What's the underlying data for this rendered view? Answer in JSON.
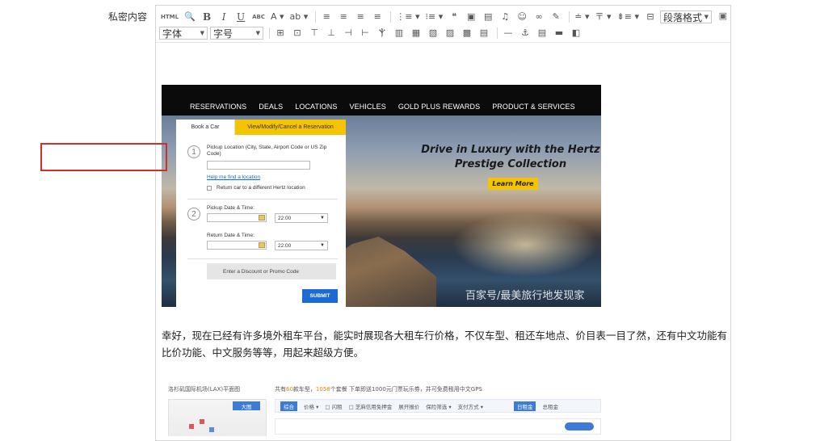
{
  "field": {
    "label": "私密内容"
  },
  "toolbar": {
    "row1": [
      {
        "name": "source-code-button",
        "glyph": "HTML",
        "cls": "small"
      },
      {
        "name": "preview-icon",
        "glyph": "🔍",
        "cls": ""
      },
      {
        "name": "bold-button",
        "glyph": "B",
        "cls": "bold"
      },
      {
        "name": "italic-button",
        "glyph": "I",
        "cls": "ital"
      },
      {
        "name": "underline-button",
        "glyph": "U",
        "cls": "under"
      },
      {
        "name": "strikethrough-button",
        "glyph": "ABC",
        "cls": "small"
      },
      {
        "name": "font-color-button",
        "glyph": "A ▾",
        "cls": ""
      },
      {
        "name": "background-color-button",
        "glyph": "ab ▾",
        "cls": ""
      },
      {
        "sep": true
      },
      {
        "name": "align-left-icon",
        "glyph": "≡",
        "cls": ""
      },
      {
        "name": "align-center-icon",
        "glyph": "≡",
        "cls": ""
      },
      {
        "name": "align-right-icon",
        "glyph": "≡",
        "cls": ""
      },
      {
        "name": "align-justify-icon",
        "glyph": "≡",
        "cls": ""
      },
      {
        "sep": true
      },
      {
        "name": "ordered-list-icon",
        "glyph": "⋮≡ ▾",
        "cls": ""
      },
      {
        "name": "unordered-list-icon",
        "glyph": "⁝≡ ▾",
        "cls": ""
      },
      {
        "name": "blockquote-icon",
        "glyph": "❝",
        "cls": ""
      },
      {
        "name": "image-icon",
        "glyph": "▣",
        "cls": ""
      },
      {
        "name": "file-icon",
        "glyph": "▤",
        "cls": ""
      },
      {
        "name": "music-icon",
        "glyph": "♫",
        "cls": ""
      },
      {
        "name": "emoticon-icon",
        "glyph": "☺",
        "cls": ""
      },
      {
        "name": "link-icon",
        "glyph": "∞",
        "cls": ""
      },
      {
        "name": "clear-format-icon",
        "glyph": "✎",
        "cls": ""
      },
      {
        "sep": true
      },
      {
        "name": "line-height-icon",
        "glyph": "≐ ▾",
        "cls": ""
      },
      {
        "name": "paragraph-spacing-icon",
        "glyph": "〒 ▾",
        "cls": ""
      },
      {
        "name": "indent-icon",
        "glyph": "⇟≡ ▾",
        "cls": ""
      },
      {
        "name": "direction-icon",
        "glyph": "⊟",
        "cls": ""
      }
    ],
    "paragraph_format": "段落格式",
    "font_family": "字体",
    "font_size": "字号",
    "row2": [
      {
        "name": "table-icon",
        "glyph": "⊞"
      },
      {
        "name": "insert-table-icon",
        "glyph": "⊡"
      },
      {
        "name": "insert-row-above-icon",
        "glyph": "⊤"
      },
      {
        "name": "insert-row-below-icon",
        "glyph": "⊥"
      },
      {
        "name": "insert-col-left-icon",
        "glyph": "⊣"
      },
      {
        "name": "insert-col-right-icon",
        "glyph": "⊢"
      },
      {
        "name": "delete-row-icon",
        "glyph": "Ⲯ"
      },
      {
        "name": "delete-col-icon",
        "glyph": "▥"
      },
      {
        "name": "merge-cells-icon",
        "glyph": "▦"
      },
      {
        "name": "merge-right-icon",
        "glyph": "▧"
      },
      {
        "name": "merge-down-icon",
        "glyph": "▨"
      },
      {
        "name": "split-cells-icon",
        "glyph": "▩"
      },
      {
        "name": "split-rows-icon",
        "glyph": "▤"
      },
      {
        "sep": true
      },
      {
        "name": "horizontal-rule-icon",
        "glyph": "—"
      },
      {
        "name": "anchor-icon",
        "glyph": "⚓"
      },
      {
        "name": "page-break-icon",
        "glyph": "▤"
      },
      {
        "name": "print-icon",
        "glyph": "▬"
      },
      {
        "name": "template-icon",
        "glyph": "◧"
      }
    ],
    "fullscreen_glyph": "▣"
  },
  "hertz": {
    "nav": [
      "RESERVATIONS",
      "DEALS",
      "LOCATIONS",
      "VEHICLES",
      "GOLD PLUS REWARDS",
      "PRODUCT & SERVICES"
    ],
    "tab_book": "Book a Car",
    "tab_modify": "View/Modify/Cancel a Reservation",
    "step1": "1",
    "step2": "2",
    "pickup_location_label": "Pickup Location (City, State, Airport Code or US Zip Code)",
    "help_link": "Help me find a location",
    "return_different": "Return car to a different Hertz location",
    "pickup_datetime_label": "Pickup Date & Time:",
    "return_datetime_label": "Return Date & Time:",
    "pickup_time": "22:00",
    "return_time": "22:00",
    "promo": "Enter a Discount or Promo Code",
    "submit": "SUBMIT",
    "tagline_1": "Drive in Luxury with the Hertz",
    "tagline_2": "Prestige Collection",
    "learn_more": "Learn More",
    "watermark": "百家号/最美旅行地发现家"
  },
  "paragraph": "幸好，现在已经有许多境外租车平台，能实时展现各大租车行价格，不仅车型、租还车地点、价目表一目了然，还有中文功能有比价功能、中文服务等等，用起来超级方便。",
  "lax": {
    "map_title": "洛杉矶国际机场(LAX)平面图",
    "count_prefix": "共有",
    "count_num": "60",
    "count_mid": "款车型，",
    "count_num2": "1058",
    "count_suffix": "个套餐 下单即送1000元门票玩乐券，并可免费租用中文GPS",
    "big_map": "大图",
    "filters": [
      "综合",
      "价格 ▾",
      "□ 闪租",
      "□ 芝麻信用免押金",
      "展开报价",
      "保险筛选 ▾",
      "支付方式 ▾"
    ],
    "tag1": "日租金",
    "tag2": "总租金"
  }
}
